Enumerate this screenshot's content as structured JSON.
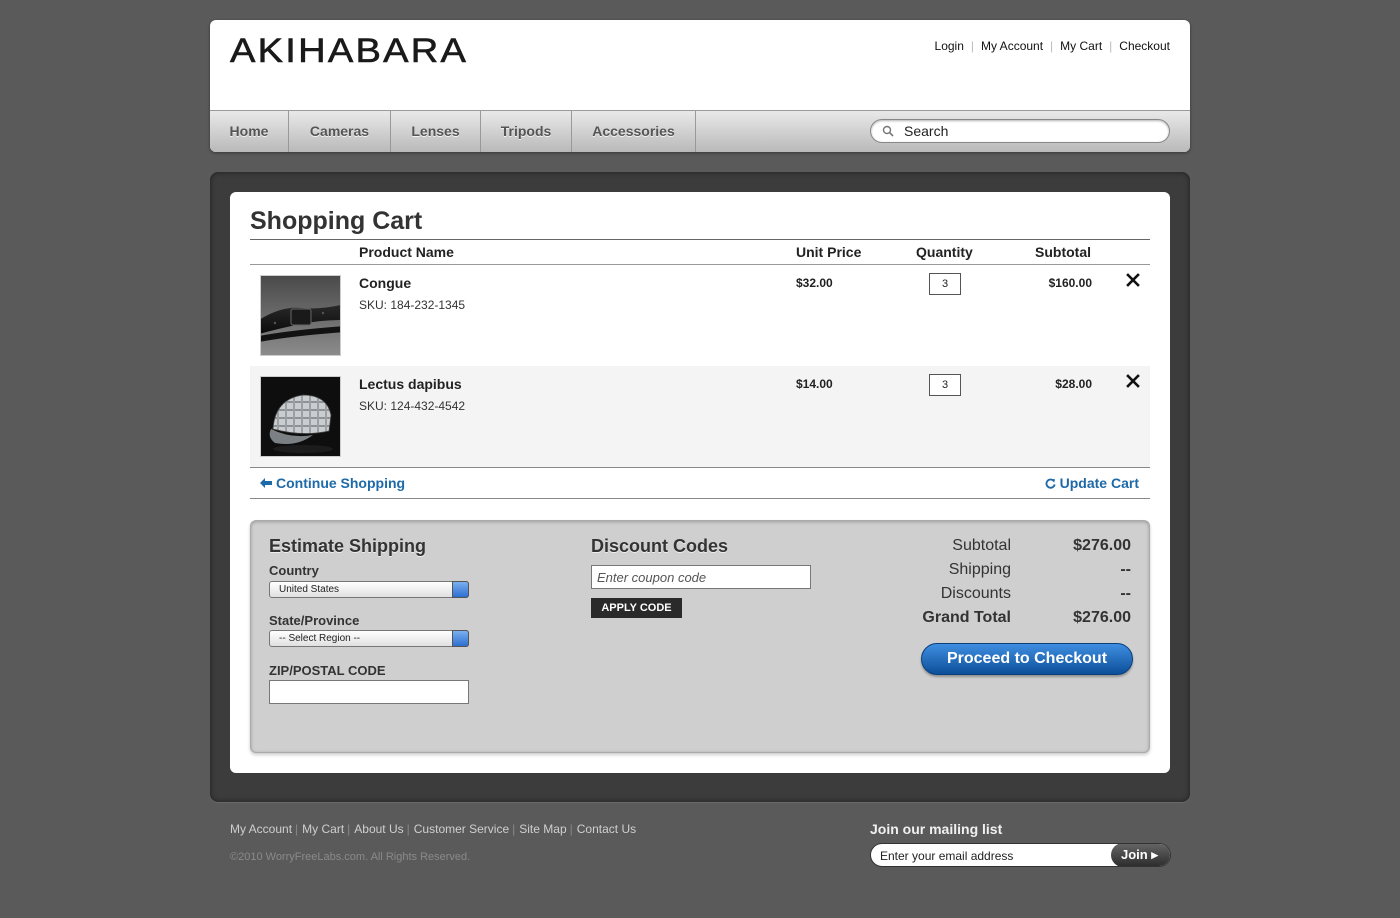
{
  "header": {
    "logo": "AKIHABARA",
    "top_links": [
      "Login",
      "My Account",
      "My Cart",
      "Checkout"
    ],
    "nav": [
      "Home",
      "Cameras",
      "Lenses",
      "Tripods",
      "Accessories"
    ],
    "search_placeholder": "Search"
  },
  "cart": {
    "title": "Shopping Cart",
    "columns": {
      "product": "Product Name",
      "unit_price": "Unit Price",
      "quantity": "Quantity",
      "subtotal": "Subtotal"
    },
    "items": [
      {
        "name": "Congue",
        "sku": "SKU: 184-232-1345",
        "unit_price": "$32.00",
        "quantity": "3",
        "subtotal": "$160.00",
        "image": "belt-photo"
      },
      {
        "name": "Lectus dapibus",
        "sku": "SKU: 124-432-4542",
        "unit_price": "$14.00",
        "quantity": "3",
        "subtotal": "$28.00",
        "image": "plaid-cap-photo"
      }
    ],
    "continue_label": "Continue Shopping",
    "update_label": "Update Cart"
  },
  "shipping": {
    "title": "Estimate Shipping",
    "country_label": "Country",
    "country_value": "United States",
    "state_label": "State/Province",
    "state_value": "-- Select Region --",
    "zip_label": "ZIP/POSTAL CODE"
  },
  "discount": {
    "title": "Discount Codes",
    "placeholder": "Enter coupon code",
    "apply_label": "APPLY CODE"
  },
  "summary": {
    "subtotal_label": "Subtotal",
    "subtotal_value": "$276.00",
    "shipping_label": "Shipping",
    "shipping_value": "--",
    "discounts_label": "Discounts",
    "discounts_value": "--",
    "grand_label": "Grand Total",
    "grand_value": "$276.00",
    "checkout_label": "Proceed to Checkout"
  },
  "footer": {
    "links": [
      "My Account",
      "My Cart",
      "About Us",
      "Customer Service",
      "Site Map",
      "Contact Us"
    ],
    "copyright": "©2010 WorryFreeLabs.com.  All Rights Reserved.",
    "mailing_title": "Join our mailing list",
    "email_placeholder": "Enter your email address",
    "join_label": "Join ▸"
  },
  "colors": {
    "accent_blue": "#1e6aa8",
    "checkout_blue": "#0c4f9a",
    "background": "#5a5a5a"
  }
}
